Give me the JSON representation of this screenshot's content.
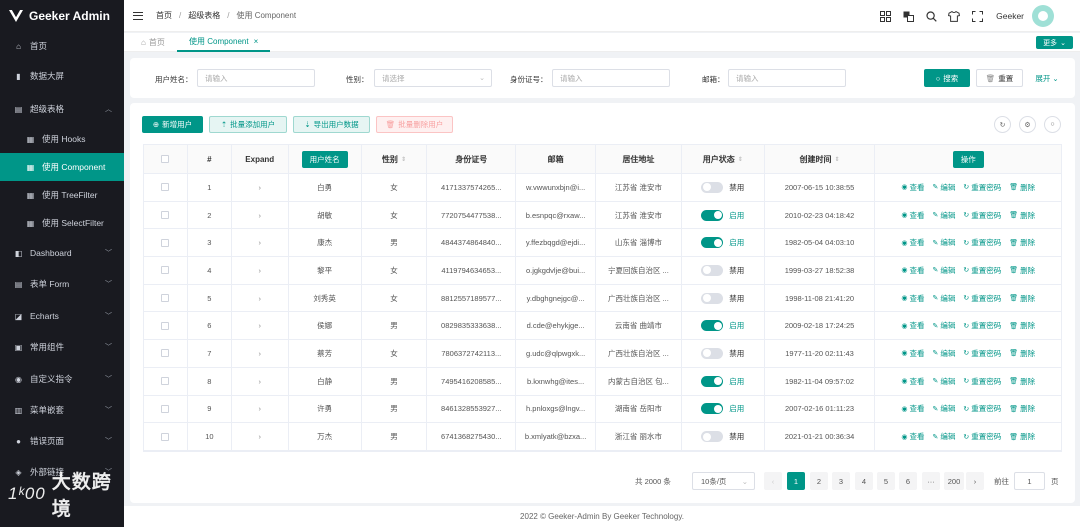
{
  "app": {
    "title": "Geeker Admin"
  },
  "sidebar": {
    "items": [
      {
        "label": "首页",
        "icon": "home-icon"
      },
      {
        "label": "数据大屏",
        "icon": "chart-icon"
      },
      {
        "label": "超级表格",
        "icon": "table-icon",
        "expanded": true
      },
      {
        "label": "使用 Hooks",
        "icon": "grid-icon",
        "sub": true
      },
      {
        "label": "使用 Component",
        "icon": "grid-icon",
        "sub": true,
        "active": true
      },
      {
        "label": "使用 TreeFilter",
        "icon": "grid-icon",
        "sub": true
      },
      {
        "label": "使用 SelectFilter",
        "icon": "grid-icon",
        "sub": true
      },
      {
        "label": "Dashboard",
        "icon": "dashboard-icon",
        "chevron": true
      },
      {
        "label": "表单 Form",
        "icon": "form-icon",
        "chevron": true
      },
      {
        "label": "Echarts",
        "icon": "echarts-icon",
        "chevron": true
      },
      {
        "label": "常用组件",
        "icon": "components-icon",
        "chevron": true
      },
      {
        "label": "自定义指令",
        "icon": "directive-icon",
        "chevron": true
      },
      {
        "label": "菜单嵌套",
        "icon": "menu-icon",
        "chevron": true
      },
      {
        "label": "错误页面",
        "icon": "error-icon",
        "chevron": true
      },
      {
        "label": "外部链接",
        "icon": "link-icon",
        "chevron": true
      }
    ],
    "watermark_logo": "1ᵏ00",
    "watermark_text": "大数跨境"
  },
  "header": {
    "breadcrumb": [
      "首页",
      "超级表格",
      "使用 Component"
    ],
    "username": "Geeker"
  },
  "tabs": {
    "home": "首页",
    "current": "使用 Component",
    "more": "更多"
  },
  "search": {
    "fields": [
      {
        "label": "用户姓名：",
        "placeholder": "请输入"
      },
      {
        "label": "性别：",
        "placeholder": "请选择"
      },
      {
        "label": "身份证号：",
        "placeholder": "请输入"
      },
      {
        "label": "邮箱：",
        "placeholder": "请输入"
      }
    ],
    "search_btn": "搜索",
    "reset_btn": "重置",
    "expand_btn": "展开"
  },
  "toolbar": {
    "add": "新增用户",
    "batch_add": "批量添加用户",
    "export": "导出用户数据",
    "batch_delete": "批量删除用户"
  },
  "table": {
    "headers": {
      "index": "#",
      "expand": "Expand",
      "name": "用户姓名",
      "gender": "性别",
      "idcard": "身份证号",
      "email": "邮箱",
      "address": "居住地址",
      "status": "用户状态",
      "created": "创建时间",
      "ops": "操作"
    },
    "actions": {
      "view": "查看",
      "edit": "编辑",
      "reset": "重置密码",
      "delete": "删除"
    },
    "status_labels": {
      "on": "启用",
      "off": "禁用"
    },
    "rows": [
      {
        "idx": "1",
        "name": "白勇",
        "gender": "女",
        "idcard": "4171337574265...",
        "email": "w.vwwunxbjn@i...",
        "address": "江苏省 淮安市",
        "status": false,
        "created": "2007-06-15 10:38:55"
      },
      {
        "idx": "2",
        "name": "胡敏",
        "gender": "女",
        "idcard": "7720754477538...",
        "email": "b.esnpqc@rxaw...",
        "address": "江苏省 淮安市",
        "status": true,
        "created": "2010-02-23 04:18:42"
      },
      {
        "idx": "3",
        "name": "康杰",
        "gender": "男",
        "idcard": "4844374864840...",
        "email": "y.ffezbqgd@ejdi...",
        "address": "山东省 淄博市",
        "status": true,
        "created": "1982-05-04 04:03:10"
      },
      {
        "idx": "4",
        "name": "黎平",
        "gender": "女",
        "idcard": "4119794634653...",
        "email": "o.jgkgdvlje@bui...",
        "address": "宁夏回族自治区 ...",
        "status": false,
        "created": "1999-03-27 18:52:38"
      },
      {
        "idx": "5",
        "name": "刘秀英",
        "gender": "女",
        "idcard": "8812557189577...",
        "email": "y.dbghgnejgc@...",
        "address": "广西壮族自治区 ...",
        "status": false,
        "created": "1998-11-08 21:41:20"
      },
      {
        "idx": "6",
        "name": "侯娜",
        "gender": "男",
        "idcard": "0829835333638...",
        "email": "d.cde@ehykjge...",
        "address": "云南省 曲靖市",
        "status": true,
        "created": "2009-02-18 17:24:25"
      },
      {
        "idx": "7",
        "name": "蔡芳",
        "gender": "女",
        "idcard": "7806372742113...",
        "email": "g.udc@qlpwgxk...",
        "address": "广西壮族自治区 ...",
        "status": false,
        "created": "1977-11-20 02:11:43"
      },
      {
        "idx": "8",
        "name": "白静",
        "gender": "男",
        "idcard": "7495416208585...",
        "email": "b.kxnwhg@ites...",
        "address": "内蒙古自治区 包...",
        "status": true,
        "created": "1982-11-04 09:57:02"
      },
      {
        "idx": "9",
        "name": "许勇",
        "gender": "男",
        "idcard": "8461328553927...",
        "email": "h.pnloxgs@lngv...",
        "address": "湖南省 岳阳市",
        "status": true,
        "created": "2007-02-16 01:11:23"
      },
      {
        "idx": "10",
        "name": "万杰",
        "gender": "男",
        "idcard": "6741368275430...",
        "email": "b.xmlyatk@bzxa...",
        "address": "浙江省 丽水市",
        "status": false,
        "created": "2021-01-21 00:36:34"
      }
    ]
  },
  "pagination": {
    "total": "共 2000 条",
    "page_size": "10条/页",
    "pages": [
      "1",
      "2",
      "3",
      "4",
      "5",
      "6",
      "···",
      "200"
    ],
    "current": "1",
    "goto_label": "前往",
    "goto_value": "1",
    "page_unit": "页"
  },
  "footer": {
    "text": "2022 © Geeker-Admin By Geeker Technology."
  },
  "colors": {
    "primary": "#009688",
    "sidebar_bg": "#191a20"
  }
}
